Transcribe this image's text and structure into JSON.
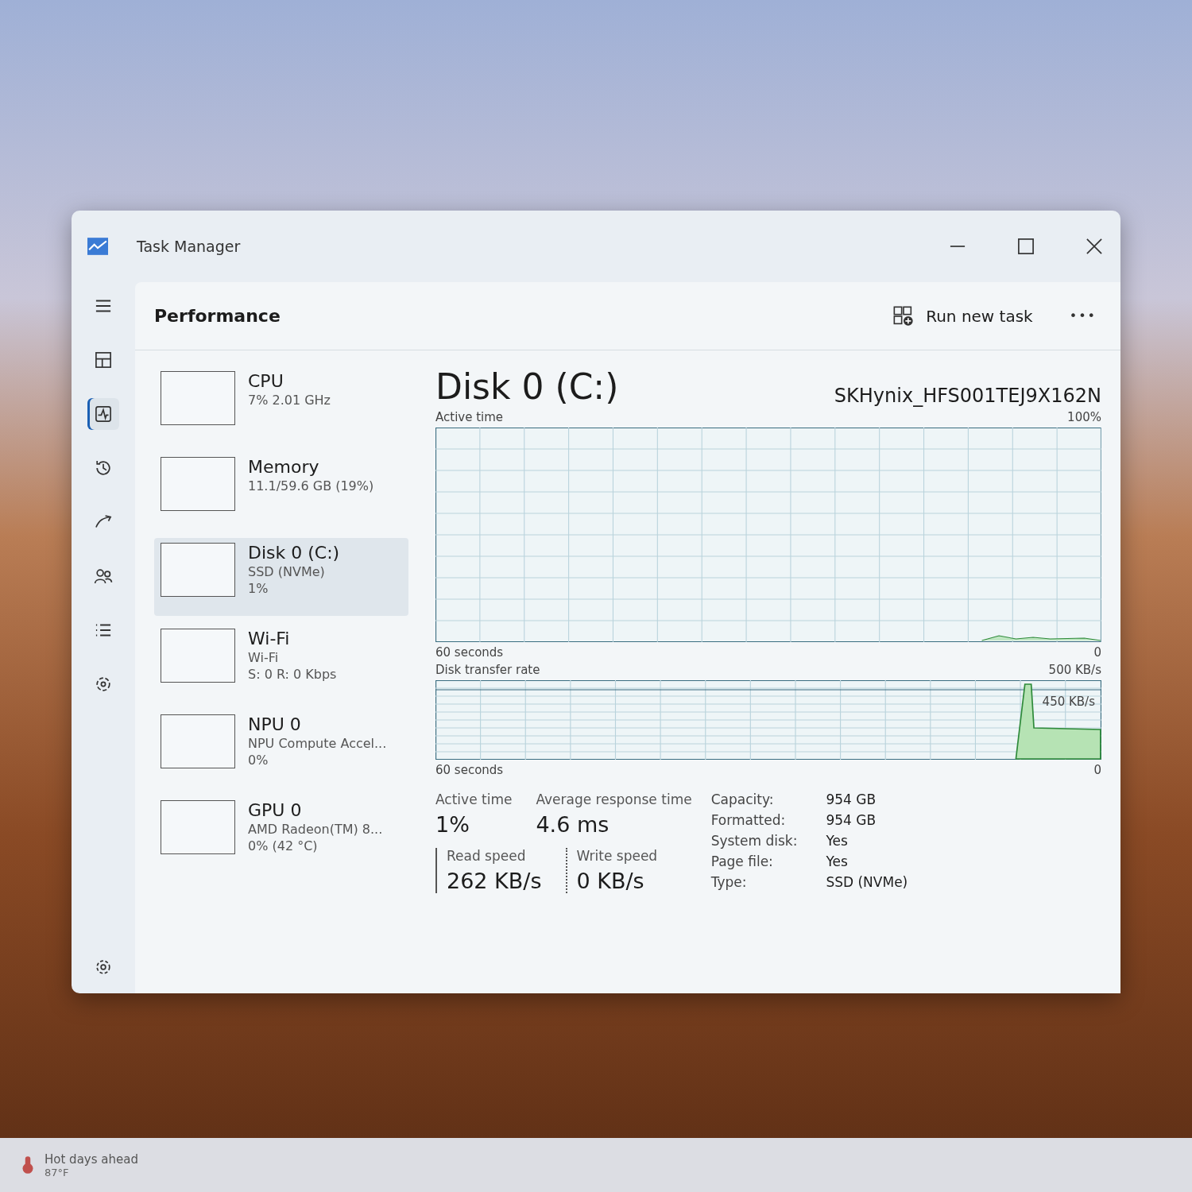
{
  "window": {
    "title": "Task Manager"
  },
  "nav": [
    {
      "kind": "menu",
      "selected": false
    },
    {
      "kind": "processes",
      "selected": false
    },
    {
      "kind": "performance",
      "selected": true
    },
    {
      "kind": "history",
      "selected": false
    },
    {
      "kind": "startup",
      "selected": false
    },
    {
      "kind": "users",
      "selected": false
    },
    {
      "kind": "details",
      "selected": false
    },
    {
      "kind": "services",
      "selected": false
    }
  ],
  "header": {
    "title": "Performance",
    "run_task": "Run new task",
    "more": "•••"
  },
  "devices": [
    {
      "name": "CPU",
      "lines": [
        "7% 2.01 GHz"
      ],
      "selected": false
    },
    {
      "name": "Memory",
      "lines": [
        "11.1/59.6 GB (19%)"
      ],
      "selected": false
    },
    {
      "name": "Disk 0 (C:)",
      "lines": [
        "SSD (NVMe)",
        "1%"
      ],
      "selected": true
    },
    {
      "name": "Wi-Fi",
      "lines": [
        "Wi-Fi",
        "S: 0 R: 0 Kbps"
      ],
      "selected": false
    },
    {
      "name": "NPU 0",
      "lines": [
        "NPU Compute Accel...",
        "0%"
      ],
      "selected": false
    },
    {
      "name": "GPU 0",
      "lines": [
        "AMD Radeon(TM) 8...",
        "0% (42 °C)"
      ],
      "selected": false
    }
  ],
  "detail": {
    "title": "Disk 0 (C:)",
    "model": "SKHynix_HFS001TEJ9X162N",
    "active_graph": {
      "label": "Active time",
      "max": "100%",
      "span": "60 seconds",
      "min": "0"
    },
    "transfer_graph": {
      "label": "Disk transfer rate",
      "max": "500 KB/s",
      "mark": "450 KB/s",
      "span": "60 seconds",
      "min": "0"
    },
    "stats": [
      {
        "label": "Active time",
        "value": "1%"
      },
      {
        "label": "Average response time",
        "value": "4.6 ms"
      }
    ],
    "speeds": [
      {
        "label": "Read speed",
        "value": "262 KB/s",
        "kind": "solid"
      },
      {
        "label": "Write speed",
        "value": "0 KB/s",
        "kind": "dotted"
      }
    ],
    "properties": [
      {
        "label": "Capacity:",
        "value": "954 GB"
      },
      {
        "label": "Formatted:",
        "value": "954 GB"
      },
      {
        "label": "System disk:",
        "value": "Yes"
      },
      {
        "label": "Page file:",
        "value": "Yes"
      },
      {
        "label": "Type:",
        "value": "SSD (NVMe)"
      }
    ]
  },
  "taskbar": {
    "weather": {
      "title": "Hot days ahead",
      "temp": "87°F"
    }
  }
}
